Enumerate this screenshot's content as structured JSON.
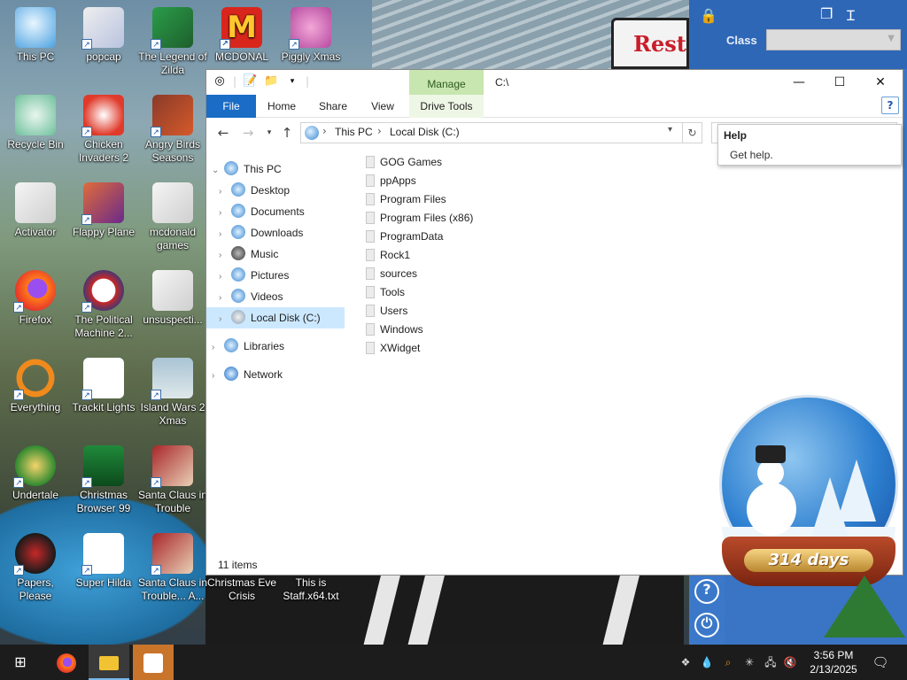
{
  "desktop": {
    "icons": [
      {
        "label": "This PC"
      },
      {
        "label": "popcap"
      },
      {
        "label": "The Legend of Zilda"
      },
      {
        "label": "MCDONAL"
      },
      {
        "label": "Piggly Xmas"
      },
      {
        "label": "Recycle Bin"
      },
      {
        "label": "Chicken Invaders 2"
      },
      {
        "label": "Angry Birds Seasons"
      },
      {
        "label": "Activator"
      },
      {
        "label": "Flappy Plane"
      },
      {
        "label": "mcdonald games"
      },
      {
        "label": "Firefox"
      },
      {
        "label": "The Political Machine 2..."
      },
      {
        "label": "unsuspecti..."
      },
      {
        "label": "Everything"
      },
      {
        "label": "Trackit Lights"
      },
      {
        "label": "Island Wars 2 Xmas"
      },
      {
        "label": "Undertale"
      },
      {
        "label": "Christmas Browser 99"
      },
      {
        "label": "Santa Claus in Trouble"
      },
      {
        "label": "Papers, Please"
      },
      {
        "label": "Super Hilda"
      },
      {
        "label": "Santa Claus in Trouble... A..."
      },
      {
        "label": "Christmas Eve Crisis"
      },
      {
        "label": "This is Staff.x64.txt"
      }
    ],
    "background_sign_text": "Rest"
  },
  "side_window": {
    "class_label": "Class",
    "class_select_value": ""
  },
  "explorer": {
    "title": "C:\\",
    "manage_tab": "Manage",
    "ribbon_tabs": [
      "File",
      "Home",
      "Share",
      "View",
      "Drive Tools"
    ],
    "address": {
      "segments": [
        "This PC",
        "Local Disk (C:)"
      ]
    },
    "nav_tree": [
      {
        "label": "This PC",
        "icon": "computer-icon"
      },
      {
        "label": "Desktop",
        "icon": "desktop-icon"
      },
      {
        "label": "Documents",
        "icon": "documents-icon"
      },
      {
        "label": "Downloads",
        "icon": "downloads-icon"
      },
      {
        "label": "Music",
        "icon": "music-icon"
      },
      {
        "label": "Pictures",
        "icon": "pictures-icon"
      },
      {
        "label": "Videos",
        "icon": "videos-icon"
      },
      {
        "label": "Local Disk (C:)",
        "icon": "disk-icon"
      },
      {
        "label": "Libraries",
        "icon": "libraries-icon"
      },
      {
        "label": "Network",
        "icon": "network-icon"
      }
    ],
    "files": [
      "GOG Games",
      "ppApps",
      "Program Files",
      "Program Files (x86)",
      "ProgramData",
      "Rock1",
      "sources",
      "Tools",
      "Users",
      "Windows",
      "XWidget"
    ],
    "status": "11 items",
    "tooltip": {
      "title": "Help",
      "body": "Get help."
    }
  },
  "widget": {
    "days_label": "314 days"
  },
  "taskbar": {
    "time": "3:56 PM",
    "date": "2/13/2025"
  }
}
